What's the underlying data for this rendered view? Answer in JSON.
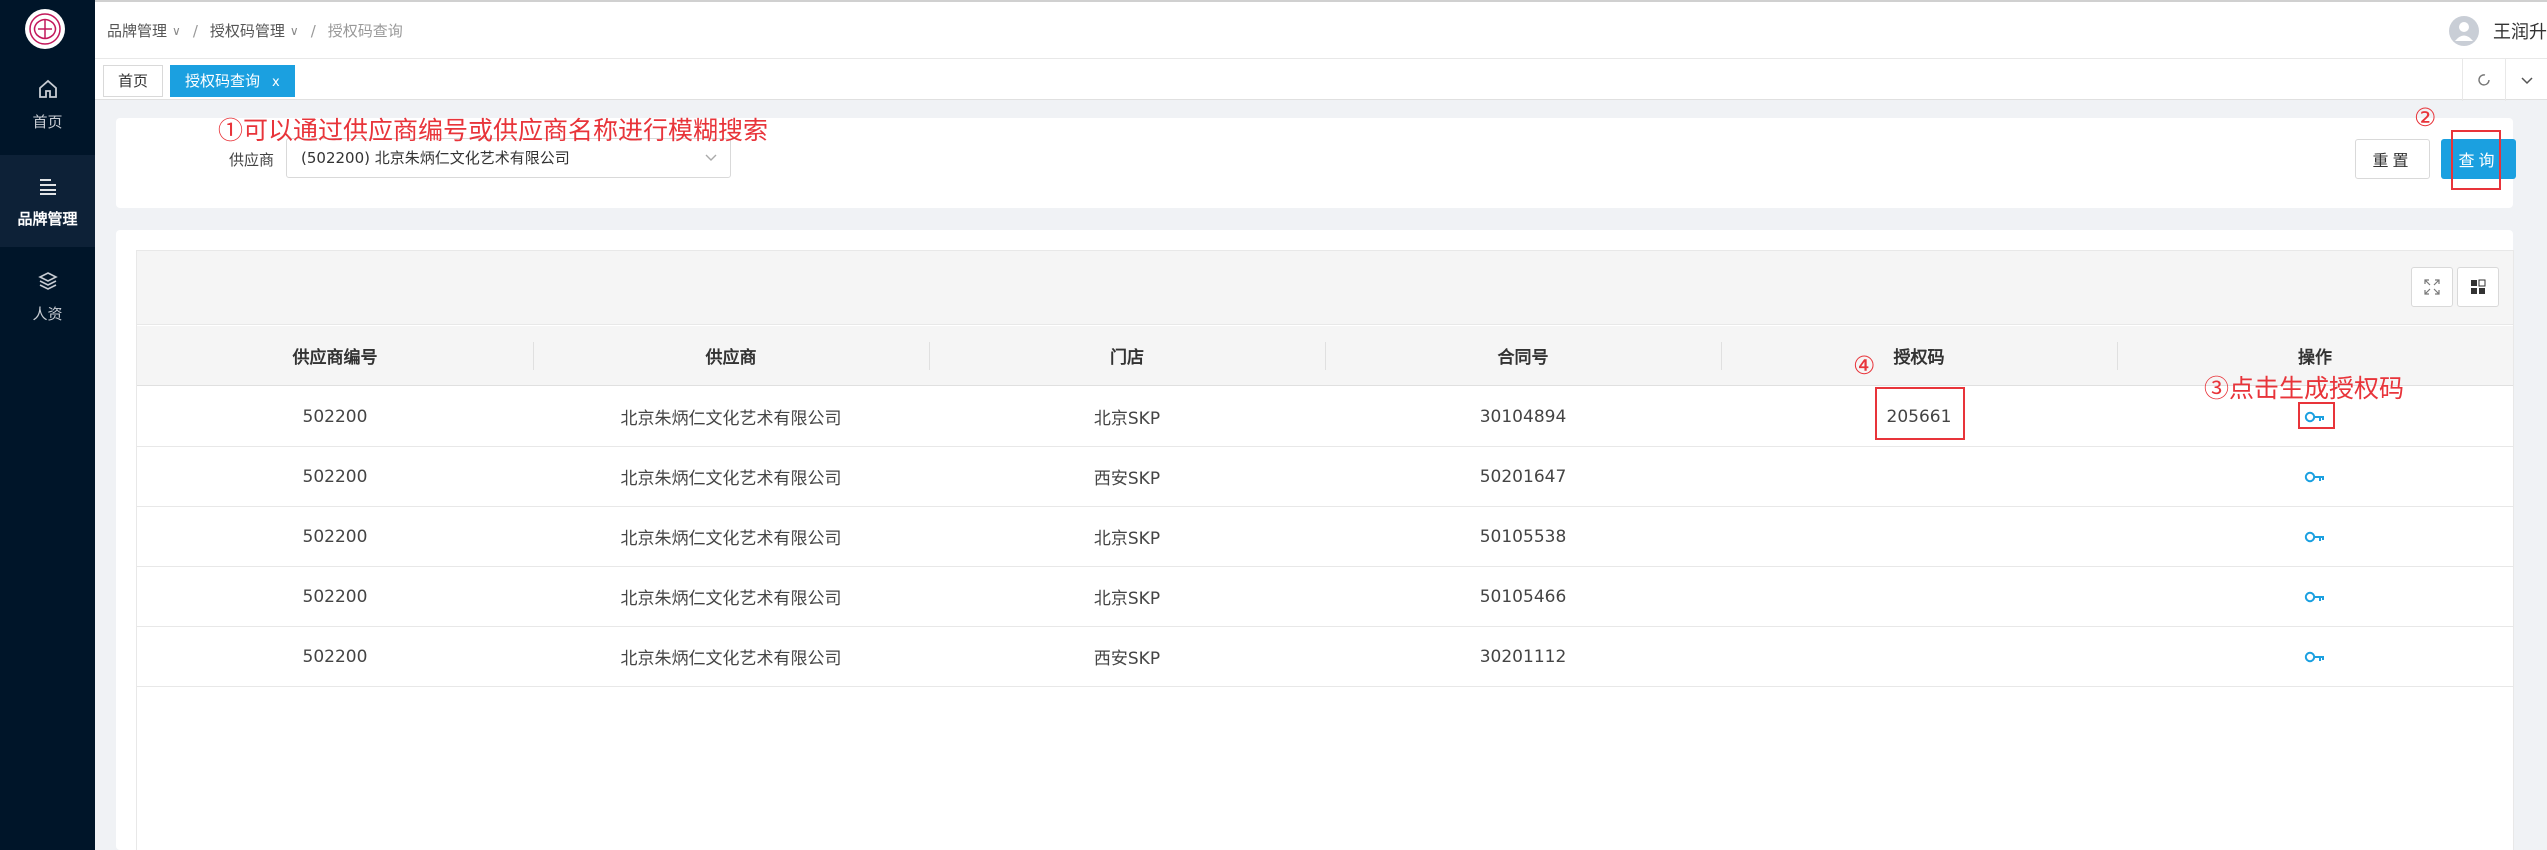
{
  "sidebar": {
    "logo_icon": "brand-logo-icon",
    "items": [
      {
        "label": "首页",
        "icon": "home-icon"
      },
      {
        "label": "品牌管理",
        "icon": "list-icon"
      },
      {
        "label": "人资",
        "icon": "layers-icon"
      }
    ]
  },
  "header": {
    "breadcrumb": [
      "品牌管理",
      "授权码管理",
      "授权码查询"
    ],
    "user_name": "王润升"
  },
  "tabs": [
    {
      "label": "首页"
    },
    {
      "label": "授权码查询",
      "close": "x"
    }
  ],
  "search": {
    "label": "供应商",
    "value": "(502200) 北京朱炳仁文化艺术有限公司",
    "reset_label": "重置",
    "query_label": "查询"
  },
  "table": {
    "columns": [
      "供应商编号",
      "供应商",
      "门店",
      "合同号",
      "授权码",
      "操作"
    ],
    "rows": [
      {
        "code": "502200",
        "supplier": "北京朱炳仁文化艺术有限公司",
        "store": "北京SKP",
        "contract": "30104894",
        "auth": "205661"
      },
      {
        "code": "502200",
        "supplier": "北京朱炳仁文化艺术有限公司",
        "store": "西安SKP",
        "contract": "50201647",
        "auth": ""
      },
      {
        "code": "502200",
        "supplier": "北京朱炳仁文化艺术有限公司",
        "store": "北京SKP",
        "contract": "50105538",
        "auth": ""
      },
      {
        "code": "502200",
        "supplier": "北京朱炳仁文化艺术有限公司",
        "store": "北京SKP",
        "contract": "50105466",
        "auth": ""
      },
      {
        "code": "502200",
        "supplier": "北京朱炳仁文化艺术有限公司",
        "store": "西安SKP",
        "contract": "30201112",
        "auth": ""
      }
    ]
  },
  "annotations": {
    "a1": "①可以通过供应商编号或供应商名称进行模糊搜索",
    "a2": "②",
    "a3": "③点击生成授权码",
    "a4": "④"
  },
  "colors": {
    "accent": "#1ba0e0",
    "sidebar": "#001529",
    "annotation": "#e8343a"
  }
}
